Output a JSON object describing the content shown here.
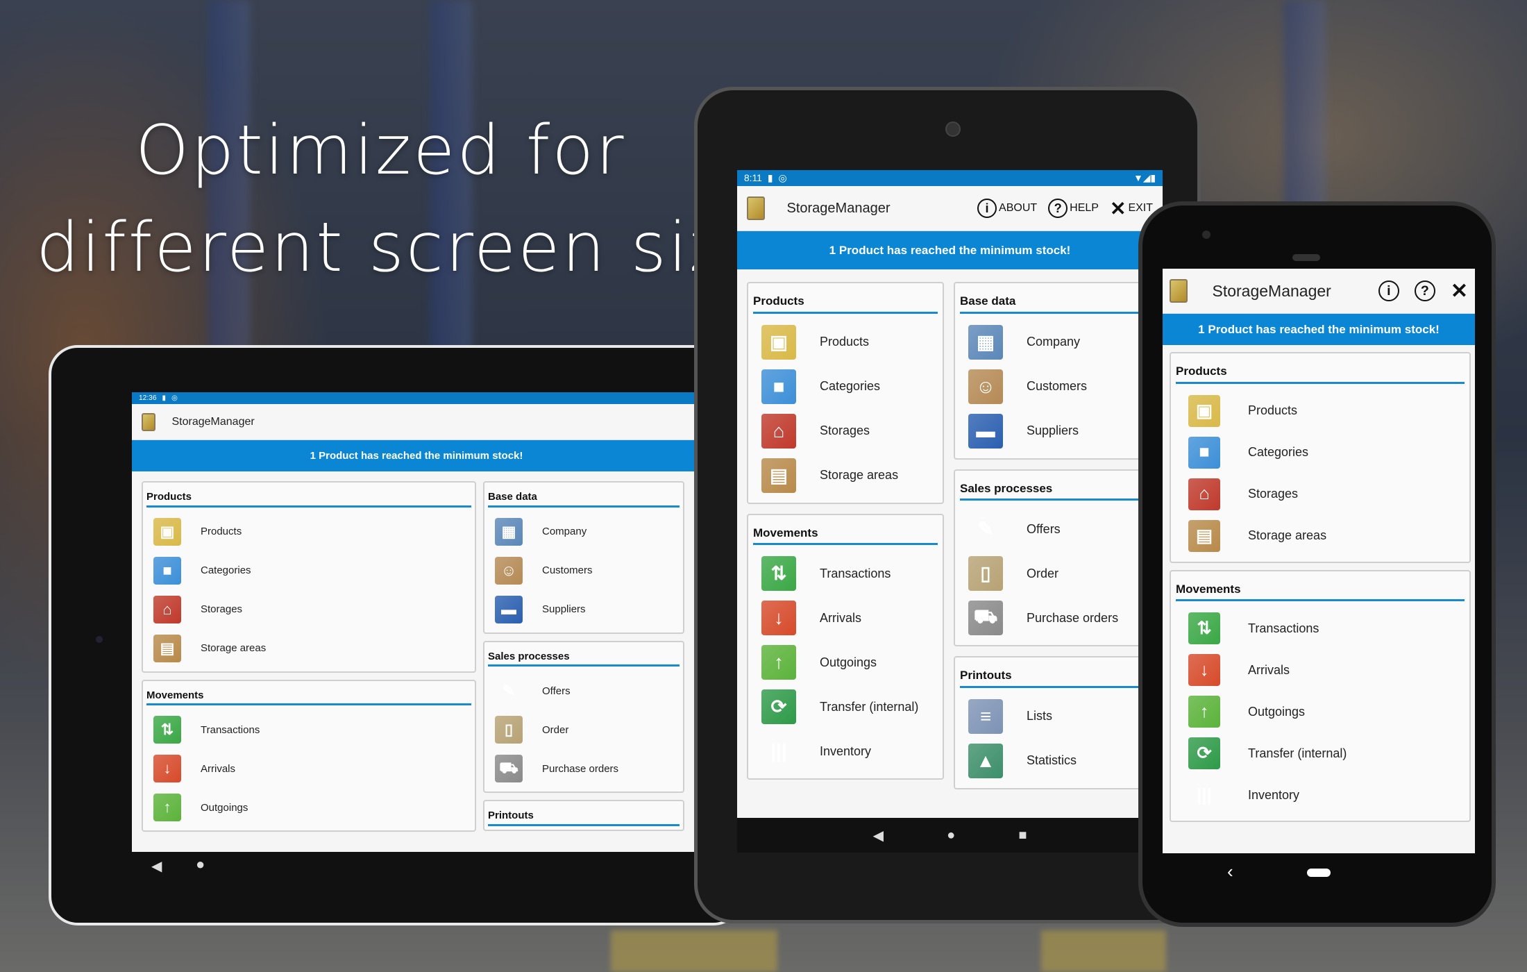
{
  "headline": {
    "line1": "Optimized for",
    "line2": "different screen sizes"
  },
  "app": {
    "title": "StorageManager",
    "banner": "1 Product has reached the minimum stock!",
    "about": "ABOUT",
    "help": "HELP",
    "exit": "EXIT",
    "accent": "#0b86d4",
    "status_color": "#0a7ac4"
  },
  "devices": {
    "landscape_tablet": {
      "time": "12:36"
    },
    "portrait_tablet": {
      "time": "8:11"
    },
    "phone": {}
  },
  "sections": {
    "products": {
      "title": "Products",
      "items": [
        {
          "label": "Products",
          "icon": "box-icon"
        },
        {
          "label": "Categories",
          "icon": "cubes-icon"
        },
        {
          "label": "Storages",
          "icon": "house-icon"
        },
        {
          "label": "Storage areas",
          "icon": "shelf-icon"
        }
      ]
    },
    "movements": {
      "title": "Movements",
      "items": [
        {
          "label": "Transactions",
          "icon": "arrows-up-down-icon"
        },
        {
          "label": "Arrivals",
          "icon": "box-in-icon"
        },
        {
          "label": "Outgoings",
          "icon": "box-out-icon"
        },
        {
          "label": "Transfer (internal)",
          "icon": "transfer-icon"
        },
        {
          "label": "Inventory",
          "icon": "barcode-icon"
        }
      ]
    },
    "base": {
      "title": "Base data",
      "items": [
        {
          "label": "Company",
          "icon": "building-icon"
        },
        {
          "label": "Customers",
          "icon": "people-icon"
        },
        {
          "label": "Suppliers",
          "icon": "truck-icon"
        }
      ]
    },
    "sales": {
      "title": "Sales processes",
      "items": [
        {
          "label": "Offers",
          "icon": "document-pen-icon"
        },
        {
          "label": "Order",
          "icon": "clipboard-icon"
        },
        {
          "label": "Purchase orders",
          "icon": "cart-icon"
        }
      ]
    },
    "printouts": {
      "title": "Printouts",
      "items": [
        {
          "label": "Lists",
          "icon": "list-icon"
        },
        {
          "label": "Statistics",
          "icon": "chart-icon"
        }
      ]
    }
  }
}
